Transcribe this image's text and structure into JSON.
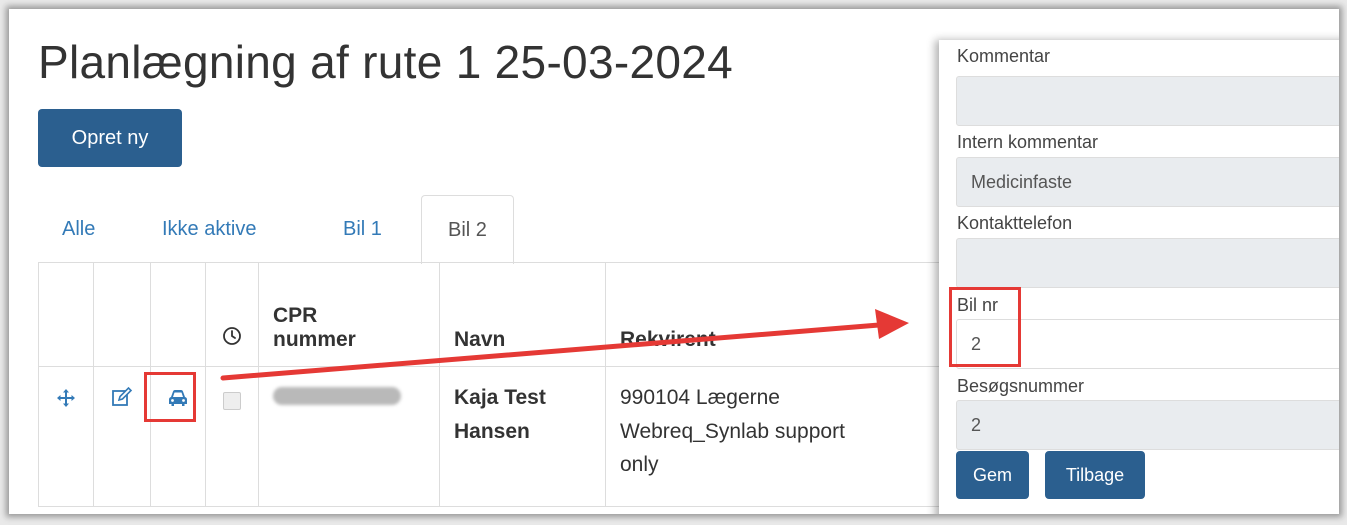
{
  "page": {
    "title": "Planlægning af rute 1 25-03-2024",
    "create_button": "Opret ny"
  },
  "tabs": [
    {
      "label": "Alle",
      "active": false
    },
    {
      "label": "Ikke aktive",
      "active": false
    },
    {
      "label": "Bil 1",
      "active": false
    },
    {
      "label": "Bil 2",
      "active": true
    }
  ],
  "table": {
    "headers": {
      "clock": "clock-icon",
      "cpr_line1": "CPR",
      "cpr_line2": "nummer",
      "navn": "Navn",
      "rekvirent": "Rekvirent"
    },
    "rows": [
      {
        "name_line1": "Kaja Test",
        "name_line2": "Hansen",
        "rekvirent_line1": "990104 Lægerne",
        "rekvirent_line2": "Webreq_Synlab support",
        "rekvirent_line3": "only",
        "icons": [
          "move-icon",
          "edit-icon",
          "car-icon"
        ]
      }
    ]
  },
  "panel": {
    "kommentar_label": "Kommentar",
    "kommentar_value": "",
    "intern_label": "Intern kommentar",
    "intern_value": "Medicinfaste",
    "kontakt_label": "Kontakttelefon",
    "kontakt_value": "",
    "bil_label": "Bil nr",
    "bil_value": "2",
    "besog_label": "Besøgsnummer",
    "besog_value": "2",
    "save_button": "Gem",
    "back_button": "Tilbage"
  },
  "colors": {
    "primary": "#2b5f8f",
    "link": "#337ab7",
    "annotation": "#e53935"
  }
}
